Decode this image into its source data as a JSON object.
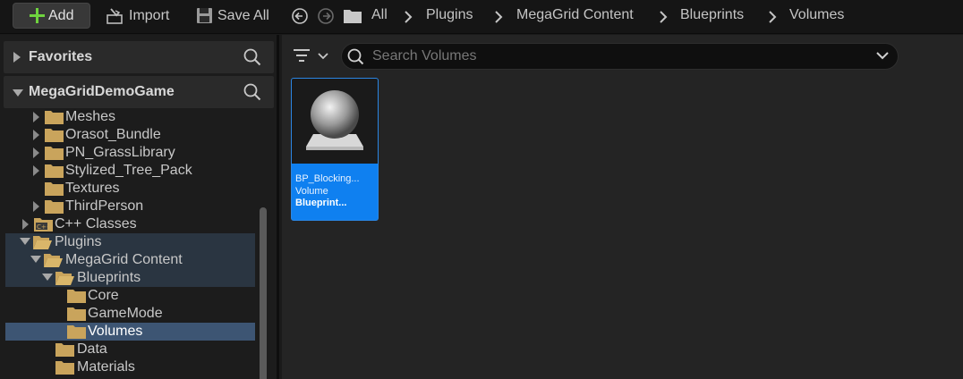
{
  "toolbar": {
    "add_label": "Add",
    "import_label": "Import",
    "save_all_label": "Save All"
  },
  "breadcrumb": [
    "All",
    "Plugins",
    "MegaGrid Content",
    "Blueprints",
    "Volumes"
  ],
  "left": {
    "favorites_label": "Favorites",
    "project_label": "MegaGridDemoGame",
    "tree": [
      {
        "label": "Meshes",
        "expanded": false
      },
      {
        "label": "Orasot_Bundle",
        "expanded": false
      },
      {
        "label": "PN_GrassLibrary",
        "expanded": false
      },
      {
        "label": "Stylized_Tree_Pack",
        "expanded": false
      },
      {
        "label": "Textures"
      },
      {
        "label": "ThirdPerson",
        "expanded": false
      },
      {
        "label": "C++ Classes",
        "expanded": false
      },
      {
        "label": "Plugins",
        "expanded": true
      },
      {
        "label": "MegaGrid Content",
        "expanded": true
      },
      {
        "label": "Blueprints",
        "expanded": true
      },
      {
        "label": "Core"
      },
      {
        "label": "GameMode"
      },
      {
        "label": "Volumes",
        "selected": true
      },
      {
        "label": "Data"
      },
      {
        "label": "Materials"
      }
    ]
  },
  "content": {
    "search_placeholder": "Search Volumes",
    "asset": {
      "name_line1": "BP_Blocking...",
      "name_line2": "Volume",
      "type": "Blueprint..."
    }
  },
  "colors": {
    "folder": "#c9a45c",
    "accent": "#0f80f0",
    "add_plus": "#6fd33f",
    "selected_row": "#3d5573"
  }
}
